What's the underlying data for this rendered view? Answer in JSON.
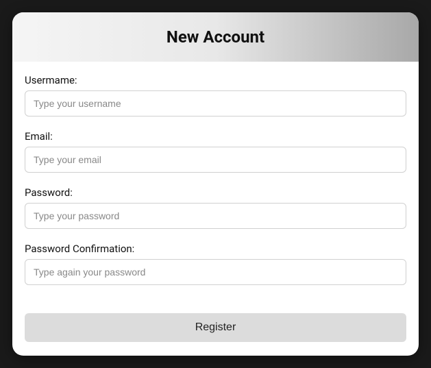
{
  "header": {
    "title": "New Account"
  },
  "form": {
    "username": {
      "label": "Usermame:",
      "placeholder": "Type your username",
      "value": ""
    },
    "email": {
      "label": "Email:",
      "placeholder": "Type your email",
      "value": ""
    },
    "password": {
      "label": "Password:",
      "placeholder": "Type your password",
      "value": ""
    },
    "password_confirmation": {
      "label": "Password Confirmation:",
      "placeholder": "Type again your password",
      "value": ""
    },
    "submit_label": "Register"
  }
}
